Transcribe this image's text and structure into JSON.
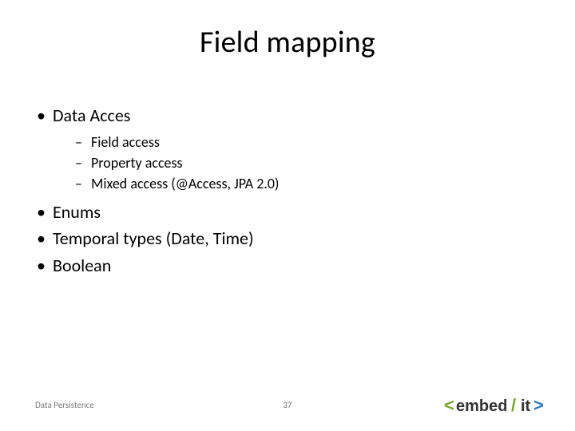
{
  "title": "Field mapping",
  "bullets": {
    "b1": "Data Acces",
    "b1_sub": {
      "s1": "Field access",
      "s2": "Property access",
      "s3": "Mixed access (@Access, JPA 2.0)"
    },
    "b2": "Enums",
    "b3": "Temporal types (Date, Time)",
    "b4": "Boolean"
  },
  "footer": {
    "left": "Data Persistence",
    "page": "37"
  },
  "logo": {
    "lt_color": "#7aa52e",
    "gt_color": "#2e7bc0",
    "slash_color": "#7aa52e",
    "text_embed": "embed",
    "text_it": "it"
  }
}
